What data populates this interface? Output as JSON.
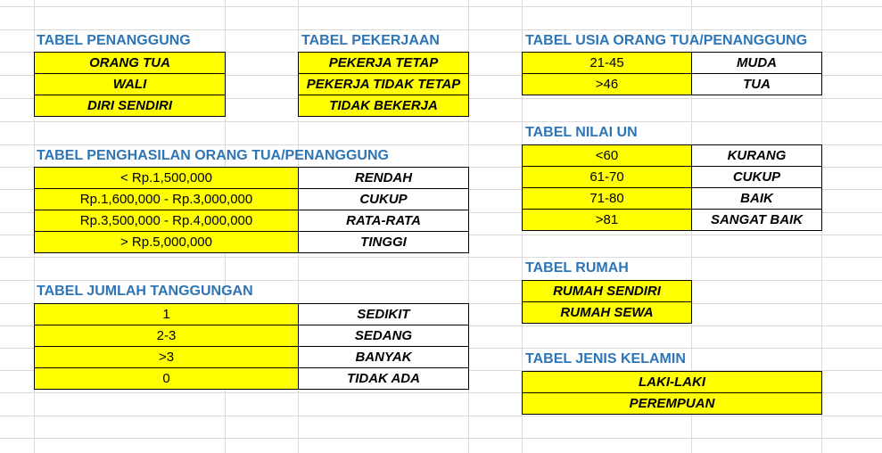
{
  "penanggung": {
    "title": "TABEL PENANGGUNG",
    "rows": [
      "ORANG TUA",
      "WALI",
      "DIRI SENDIRI"
    ]
  },
  "pekerjaan": {
    "title": "TABEL PEKERJAAN",
    "rows": [
      "PEKERJA TETAP",
      "PEKERJA TIDAK TETAP",
      "TIDAK BEKERJA"
    ]
  },
  "usia": {
    "title": "TABEL USIA ORANG TUA/PENANGGUNG",
    "rows": [
      {
        "range": "21-45",
        "label": "MUDA"
      },
      {
        "range": ">46",
        "label": "TUA"
      }
    ]
  },
  "penghasilan": {
    "title": "TABEL PENGHASILAN ORANG TUA/PENANGGUNG",
    "rows": [
      {
        "range": "< Rp.1,500,000",
        "label": "RENDAH"
      },
      {
        "range": "Rp.1,600,000 - Rp.3,000,000",
        "label": "CUKUP"
      },
      {
        "range": "Rp.3,500,000 - Rp.4,000,000",
        "label": "RATA-RATA"
      },
      {
        "range": "> Rp.5,000,000",
        "label": "TINGGI"
      }
    ]
  },
  "nilai_un": {
    "title": "TABEL NILAI UN",
    "rows": [
      {
        "range": "<60",
        "label": "KURANG"
      },
      {
        "range": "61-70",
        "label": "CUKUP"
      },
      {
        "range": "71-80",
        "label": "BAIK"
      },
      {
        "range": ">81",
        "label": "SANGAT BAIK"
      }
    ]
  },
  "rumah": {
    "title": "TABEL  RUMAH",
    "rows": [
      "RUMAH SENDIRI",
      "RUMAH SEWA"
    ]
  },
  "tanggungan": {
    "title": "TABEL JUMLAH TANGGUNGAN",
    "rows": [
      {
        "range": "1",
        "label": "SEDIKIT"
      },
      {
        "range": "2-3",
        "label": "SEDANG"
      },
      {
        "range": ">3",
        "label": "BANYAK"
      },
      {
        "range": "0",
        "label": "TIDAK ADA"
      }
    ]
  },
  "jenis_kelamin": {
    "title": "TABEL JENIS KELAMIN",
    "rows": [
      "LAKI-LAKI",
      "PEREMPUAN"
    ]
  },
  "colors": {
    "cell_fill": "#ffff00",
    "title_text": "#2e75b6",
    "gridline": "#dadada"
  }
}
